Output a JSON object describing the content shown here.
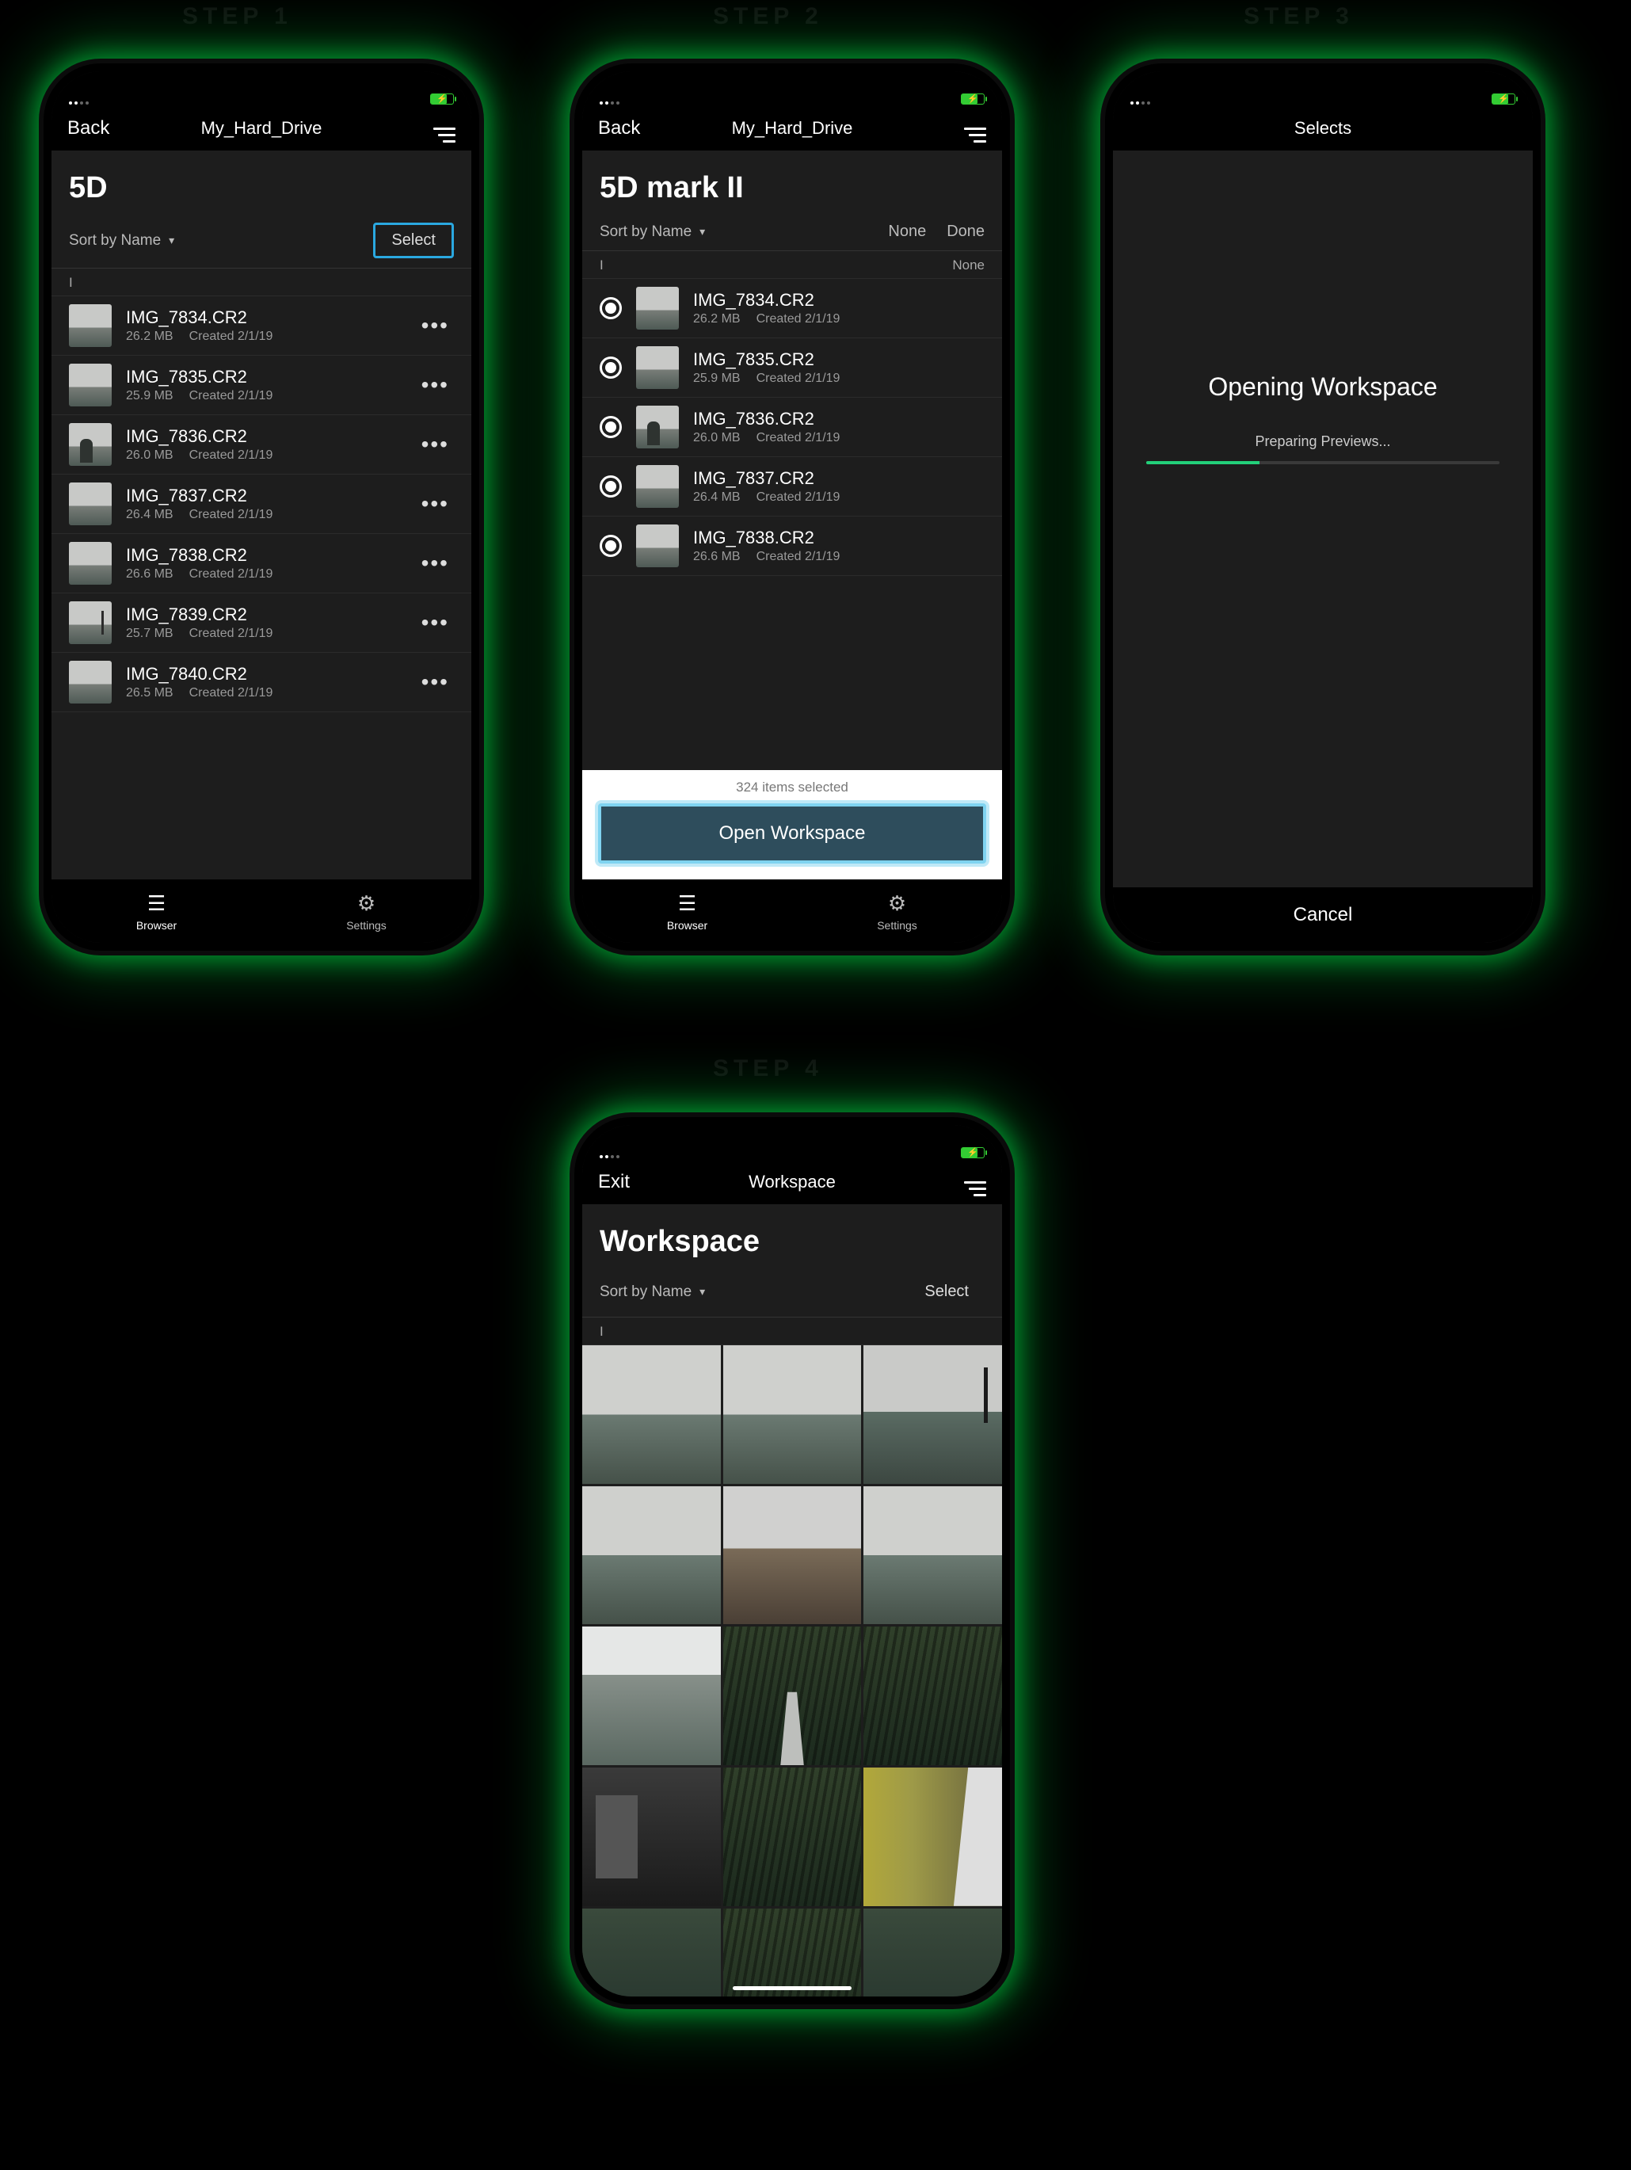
{
  "steps": {
    "s1": "STEP 1",
    "s2": "STEP 2",
    "s3": "STEP 3",
    "s4": "STEP 4"
  },
  "common": {
    "back": "Back",
    "drive": "My_Hard_Drive",
    "sort": "Sort by Name",
    "section": "I",
    "created_prefix": "Created ",
    "tab_browser": "Browser",
    "tab_settings": "Settings"
  },
  "s1": {
    "title": "5D",
    "select": "Select",
    "files": [
      {
        "name": "IMG_7834.CR2",
        "size": "26.2 MB",
        "date": "2/1/19",
        "thumb": ""
      },
      {
        "name": "IMG_7835.CR2",
        "size": "25.9 MB",
        "date": "2/1/19",
        "thumb": ""
      },
      {
        "name": "IMG_7836.CR2",
        "size": "26.0 MB",
        "date": "2/1/19",
        "thumb": "person"
      },
      {
        "name": "IMG_7837.CR2",
        "size": "26.4 MB",
        "date": "2/1/19",
        "thumb": ""
      },
      {
        "name": "IMG_7838.CR2",
        "size": "26.6 MB",
        "date": "2/1/19",
        "thumb": ""
      },
      {
        "name": "IMG_7839.CR2",
        "size": "25.7 MB",
        "date": "2/1/19",
        "thumb": "pole"
      },
      {
        "name": "IMG_7840.CR2",
        "size": "26.5 MB",
        "date": "2/1/19",
        "thumb": ""
      }
    ]
  },
  "s2": {
    "title": "5D mark II",
    "none": "None",
    "done": "Done",
    "section_right": "None",
    "files": [
      {
        "name": "IMG_7834.CR2",
        "size": "26.2 MB",
        "date": "2/1/19",
        "thumb": ""
      },
      {
        "name": "IMG_7835.CR2",
        "size": "25.9 MB",
        "date": "2/1/19",
        "thumb": ""
      },
      {
        "name": "IMG_7836.CR2",
        "size": "26.0 MB",
        "date": "2/1/19",
        "thumb": "person"
      },
      {
        "name": "IMG_7837.CR2",
        "size": "26.4 MB",
        "date": "2/1/19",
        "thumb": ""
      },
      {
        "name": "IMG_7838.CR2",
        "size": "26.6 MB",
        "date": "2/1/19",
        "thumb": ""
      }
    ],
    "count": "324 items selected",
    "open": "Open Workspace"
  },
  "s3": {
    "title_nav": "Selects",
    "title": "Opening Workspace",
    "sub": "Preparing Previews...",
    "cancel": "Cancel"
  },
  "s4": {
    "exit": "Exit",
    "title_nav": "Workspace",
    "title": "Workspace",
    "select": "Select"
  }
}
